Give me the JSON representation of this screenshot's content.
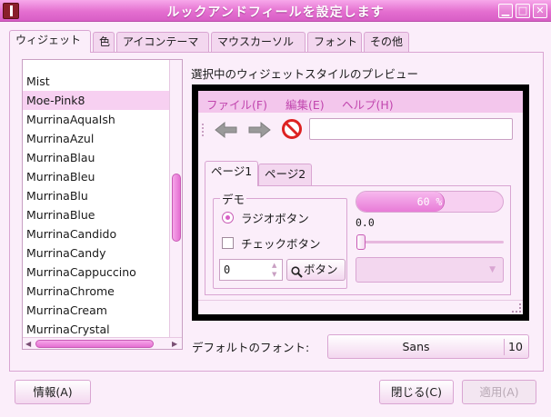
{
  "window": {
    "title": "ルックアンドフィールを設定します",
    "minimize_glyph": "▁",
    "maximize_glyph": "□",
    "close_glyph": "✕"
  },
  "tabs": [
    {
      "label": "ウィジェット",
      "active": true
    },
    {
      "label": "色"
    },
    {
      "label": "アイコンテーマ"
    },
    {
      "label": "マウスカーソル"
    },
    {
      "label": "フォント"
    },
    {
      "label": "その他"
    }
  ],
  "theme_list": {
    "items": [
      "Mist",
      "Moe-Pink8",
      "MurrinaAquaIsh",
      "MurrinaAzul",
      "MurrinaBlau",
      "MurrinaBleu",
      "MurrinaBlu",
      "MurrinaBlue",
      "MurrinaCandido",
      "MurrinaCandy",
      "MurrinaCappuccino",
      "MurrinaChrome",
      "MurrinaCream",
      "MurrinaCrystal"
    ],
    "selected": "Moe-Pink8"
  },
  "preview": {
    "label": "選択中のウィジェットスタイルのプレビュー",
    "menu": [
      "ファイル(F)",
      "編集(E)",
      "ヘルプ(H)"
    ],
    "tabs": [
      "ページ1",
      "ページ2"
    ],
    "demo_label": "デモ",
    "radio_label": "ラジオボタン",
    "check_label": "チェックボタン",
    "spin_value": "0",
    "button_label": "ボタン",
    "progress": {
      "fraction": 0.6,
      "text": "60 %"
    },
    "scale_value": "0.0"
  },
  "font": {
    "label": "デフォルトのフォント:",
    "name": "Sans",
    "size": "10"
  },
  "buttons": {
    "about": "情報(A)",
    "close": "閉じる(C)",
    "apply": "適用(A)"
  },
  "colors": {
    "accent": "#e46fd0",
    "selection": "#f7d0f1",
    "menu_text": "#c146ae"
  }
}
